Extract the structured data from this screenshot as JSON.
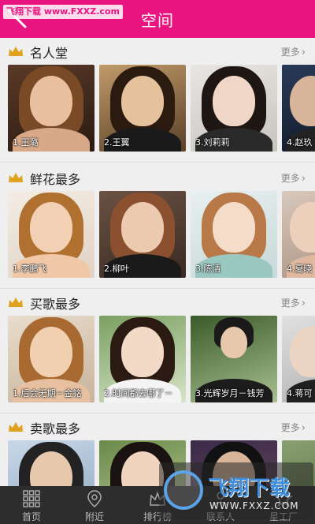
{
  "header": {
    "title": "空间",
    "watermark": "飞翔下载 www.FXXZ.com"
  },
  "sections": [
    {
      "title": "名人堂",
      "more_label": "更多",
      "items": [
        {
          "caption": "1.王璐"
        },
        {
          "caption": "2.王翼"
        },
        {
          "caption": "3.刘莉莉"
        },
        {
          "caption": "4.赵玖"
        }
      ]
    },
    {
      "title": "鲜花最多",
      "more_label": "更多",
      "items": [
        {
          "caption": "1.李鹏飞"
        },
        {
          "caption": "2.柳叶"
        },
        {
          "caption": "3.陈清"
        },
        {
          "caption": "4.夏晓"
        }
      ]
    },
    {
      "title": "买歌最多",
      "more_label": "更多",
      "items": [
        {
          "caption": "1.后会无期－金铭"
        },
        {
          "caption": "2.时间都去哪了－"
        },
        {
          "caption": "3.光辉岁月－钱芳"
        },
        {
          "caption": "4.蒋可"
        }
      ]
    },
    {
      "title": "卖歌最多",
      "more_label": "更多",
      "items": [
        {
          "caption": ""
        },
        {
          "caption": ""
        },
        {
          "caption": ""
        },
        {
          "caption": ""
        }
      ]
    }
  ],
  "tabbar": {
    "tabs": [
      {
        "label": "首页",
        "icon": "grid-icon"
      },
      {
        "label": "附近",
        "icon": "location-pin-icon"
      },
      {
        "label": "排行榜",
        "icon": "crown-icon"
      },
      {
        "label": "联系人",
        "icon": "contacts-icon"
      },
      {
        "label": "星工厂",
        "icon": "star-icon"
      }
    ]
  },
  "watermark_br": {
    "text": "飞翔下载",
    "url": "WWW.FXXZ.COM"
  },
  "colors": {
    "accent": "#e8147f",
    "tabbar_bg": "#2d2d2d",
    "crown": "#e0a21c"
  }
}
